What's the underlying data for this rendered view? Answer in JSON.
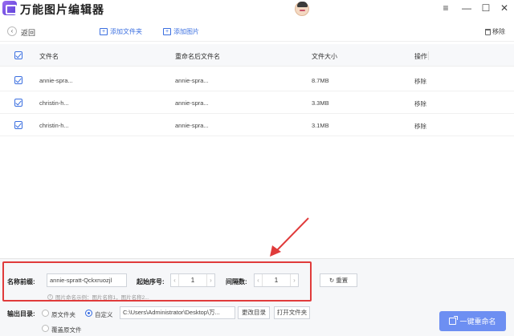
{
  "app": {
    "title": "万能图片编辑器"
  },
  "window_controls": {
    "menu": "≡",
    "minimize": "—",
    "maximize": "☐",
    "close": "✕"
  },
  "toolbar": {
    "back_label": "返回",
    "add_folder_label": "添加文件夹",
    "add_image_label": "添加图片",
    "delete_label": "移除"
  },
  "table": {
    "headers": [
      "文件名",
      "重命名后文件名",
      "文件大小",
      "操作"
    ],
    "rows": [
      {
        "name": "annie-spra...",
        "new_name": "annie-spra...",
        "size": "8.7MB",
        "action": "移除"
      },
      {
        "name": "christin-h...",
        "new_name": "annie-spra...",
        "size": "3.3MB",
        "action": "移除"
      },
      {
        "name": "christin-h...",
        "new_name": "annie-spra...",
        "size": "3.1MB",
        "action": "移除"
      }
    ]
  },
  "settings": {
    "prefix_label": "名称前缀:",
    "prefix_value": "annie-spratt-Qckxruozjl",
    "start_label": "起始序号:",
    "start_value": "1",
    "interval_label": "间隔数:",
    "interval_value": "1",
    "reset_label": "重置",
    "hint": "图片命名示例：图片名称1，图片名称2..."
  },
  "output": {
    "label": "输出目录:",
    "option_source": "原文件夹",
    "option_custom": "自定义",
    "path_value": "C:\\Users\\Administrator\\Desktop\\万...",
    "change_dir_label": "更改目录",
    "open_folder_label": "打开文件夹",
    "option_overwrite": "覆盖原文件",
    "selected": "自定义"
  },
  "action": {
    "rename_all_label": "一键重命名"
  },
  "colors": {
    "accent": "#3b6fe0",
    "primary_button": "#6d8ff2",
    "highlight": "#e03b3b"
  }
}
